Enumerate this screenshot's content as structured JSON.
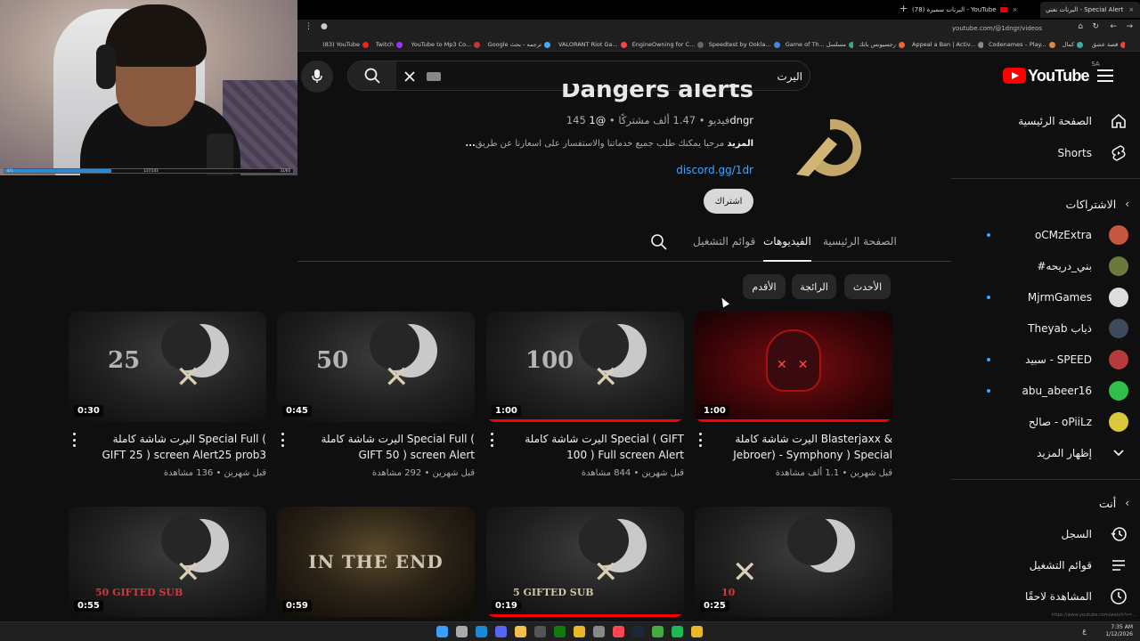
{
  "browser": {
    "tabs": [
      {
        "label": "البرنات نغني - Special Alert",
        "active": false
      },
      {
        "label": "البرنات سميرة (78) - YouTube",
        "active": true
      }
    ],
    "url": "youtube.com/@1dngr/videos",
    "bookmarks": [
      "قصة عشق",
      "كمال",
      "Codenames – Play...",
      "Appeal a Ban | Activ...",
      "رجسيونس باتك",
      "Game of Th... مسلسل",
      "Speedtest by Ookla...",
      "EngineOwning for C...",
      "VALORANT Riot Ga...",
      "Google ترجمه - بحث",
      "YouTube to Mp3 Co...",
      "Twitch",
      "(83) YouTube",
      "Kick",
      "Manu..."
    ]
  },
  "webcam": {
    "progress": 0.37,
    "progress_labels": [
      "4/1",
      "137/143",
      "31/60"
    ]
  },
  "masthead": {
    "search_value": "اليرت",
    "logo_text": "YouTube",
    "country_code": "SA"
  },
  "sidebar": {
    "home": "الصفحة الرئيسية",
    "shorts": "Shorts",
    "subs_header": "الاشتراكات",
    "subscriptions": [
      {
        "name": "oCMzExtra",
        "live": true,
        "color": "#c8553d"
      },
      {
        "name": "#بني_دريحه",
        "live": false,
        "color": "#6b7a3a"
      },
      {
        "name": "MjrmGames",
        "live": true,
        "color": "#dddddd"
      },
      {
        "name": "Theyab ذياب",
        "live": false,
        "color": "#3c4a5a"
      },
      {
        "name": "سبيد - SPEED",
        "live": true,
        "color": "#b83a3a"
      },
      {
        "name": "abu_abeer16",
        "live": true,
        "color": "#2fbf4a"
      },
      {
        "name": "صالح - oPiiLz",
        "live": false,
        "color": "#d9c93a"
      }
    ],
    "show_more": "إظهار المزيد",
    "you_header": "أنت",
    "you_items": [
      "السجل",
      "قوائم التشغيل",
      "المشاهدة لاحقًا"
    ]
  },
  "channel": {
    "name": "Dangers alerts",
    "handle": "@1dngr",
    "subscribers": "1.47 ألف مشتركًا",
    "videos": "145 فيديو",
    "description": "مرحبا يمكنك طلب جميع خدماتنا والاستفسار على اسعارنا عن طريق",
    "more": "...المزيد",
    "link": "discord.gg/1dr",
    "subscribe_label": "اشتراك"
  },
  "tabs": [
    {
      "label": "الصفحة الرئيسية",
      "active": false
    },
    {
      "label": "الفيديوهات",
      "active": true
    },
    {
      "label": "قوائم التشغيل",
      "active": false
    }
  ],
  "chips": [
    "الأحدث",
    "الرائجة",
    "الأقدم"
  ],
  "videos": [
    {
      "title": "اليرت شاشة كاملة Blasterjaxx & Jebroer) - Symphony ) Special Full screen...",
      "duration": "1:00",
      "views": "1.1 ألف مشاهدة",
      "age": "قبل شهرين",
      "progress": 1.0
    },
    {
      "title": "اليرت شاشة كاملة Special ( GIFT 100 ) Full screen Alert",
      "duration": "1:00",
      "views": "844 مشاهدة",
      "age": "قبل شهرين",
      "progress": 1.0
    },
    {
      "title": "اليرت شاشة كاملة Special Full ( GIFT 50 ) screen Alert",
      "duration": "0:45",
      "views": "292 مشاهدة",
      "age": "قبل شهرين",
      "progress": 0
    },
    {
      "title": "اليرت شاشة كاملة Special Full ( GIFT 25 ) screen Alert25 prob3",
      "duration": "0:30",
      "views": "136 مشاهدة",
      "age": "قبل شهرين",
      "progress": 0
    },
    {
      "title": "",
      "duration": "0:25",
      "views": "",
      "age": "",
      "progress": 0
    },
    {
      "title": "",
      "duration": "0:19",
      "views": "",
      "age": "",
      "progress": 1.0
    },
    {
      "title": "",
      "duration": "0:59",
      "views": "",
      "age": "",
      "progress": 0
    },
    {
      "title": "",
      "duration": "0:55",
      "views": "",
      "age": "",
      "progress": 0
    }
  ],
  "thumb_text": [
    "25",
    "50",
    "100",
    "10",
    "5 GIFTED SUB",
    "IN THE END",
    "50 GIFTED SUB"
  ],
  "taskbar": {
    "time": "7:35 AM",
    "date": "1/12/2026",
    "lang": "ع"
  },
  "status_url": "https://www.youtube.com/watch?v=..."
}
